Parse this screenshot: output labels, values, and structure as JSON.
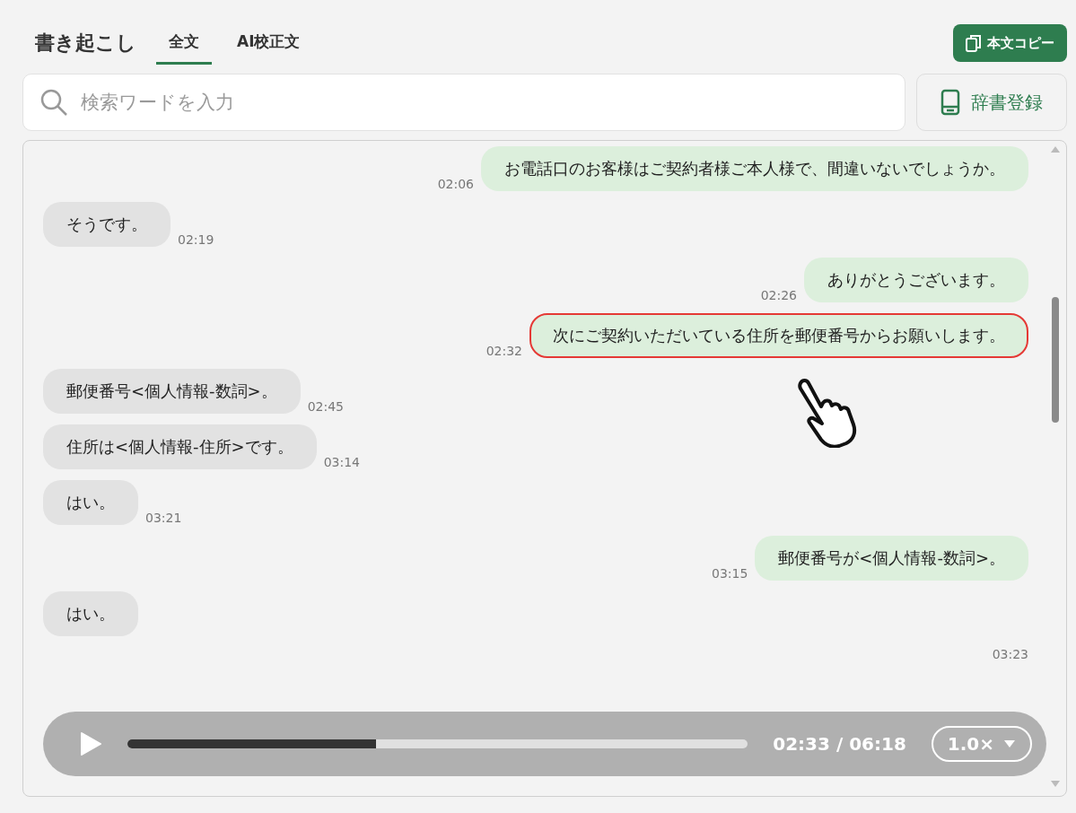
{
  "header": {
    "title": "書き起こし",
    "tabs": [
      {
        "label": "全文",
        "selected": true
      },
      {
        "label": "AI校正文",
        "selected": false
      }
    ],
    "copy_button": "本文コピー"
  },
  "search": {
    "placeholder": "検索ワードを入力"
  },
  "dictionary_button": "辞書登録",
  "messages": [
    {
      "kind": "agent",
      "text": "お電話口のお客様はご契約者様ご本人様で、間違いないでしょうか。",
      "time": "02:06",
      "highlighted": false
    },
    {
      "kind": "customer",
      "text": "そうです。",
      "time": "02:19",
      "highlighted": false
    },
    {
      "kind": "agent",
      "text": "ありがとうございます。",
      "time": "02:26",
      "highlighted": false
    },
    {
      "kind": "agent",
      "text": "次にご契約いただいている住所を郵便番号からお願いします。",
      "time": "02:32",
      "highlighted": true
    },
    {
      "kind": "customer",
      "text": "郵便番号<個人情報-数詞>。",
      "time": "02:45",
      "highlighted": false
    },
    {
      "kind": "customer",
      "text": "住所は<個人情報-住所>です。",
      "time": "03:14",
      "highlighted": false
    },
    {
      "kind": "customer",
      "text": "はい。",
      "time": "03:21",
      "highlighted": false
    },
    {
      "kind": "agent",
      "text": "郵便番号が<個人情報-数詞>。",
      "time": "03:15",
      "highlighted": false
    },
    {
      "kind": "customer",
      "text": "はい。",
      "highlighted": false
    },
    {
      "kind": "agent",
      "time": "03:23"
    }
  ],
  "player": {
    "level": 0.4,
    "time": "02:33 / 06:18",
    "speed": "1.0×"
  }
}
